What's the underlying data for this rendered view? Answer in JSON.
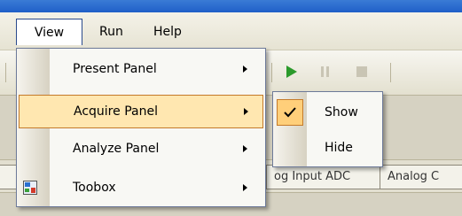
{
  "menubar": {
    "items": [
      {
        "label": "View"
      },
      {
        "label": "Run"
      },
      {
        "label": "Help"
      }
    ]
  },
  "view_menu": {
    "items": [
      {
        "label": "Present Panel",
        "has_submenu": true,
        "highlighted": false
      },
      {
        "label": "Acquire Panel",
        "has_submenu": true,
        "highlighted": true
      },
      {
        "label": "Analyze Panel",
        "has_submenu": true,
        "highlighted": false
      },
      {
        "label": "Toobox",
        "has_submenu": true,
        "highlighted": false,
        "icon": "toolbox-icon"
      }
    ]
  },
  "acquire_submenu": {
    "items": [
      {
        "label": "Show",
        "checked": true,
        "icon": "checkmark-icon"
      },
      {
        "label": "Hide",
        "checked": false
      }
    ]
  },
  "toolbar": {
    "buttons": [
      {
        "icon": "play-icon"
      },
      {
        "icon": "pause-icon"
      },
      {
        "icon": "stop-icon"
      }
    ]
  },
  "tabs": [
    {
      "label": "og Input ADC"
    },
    {
      "label": "Analog C"
    }
  ],
  "colors": {
    "accent_highlight": "#ffe7b0",
    "highlight_border": "#c47a2a",
    "menu_border": "#6d7a99",
    "play_green": "#2b9a2b"
  }
}
